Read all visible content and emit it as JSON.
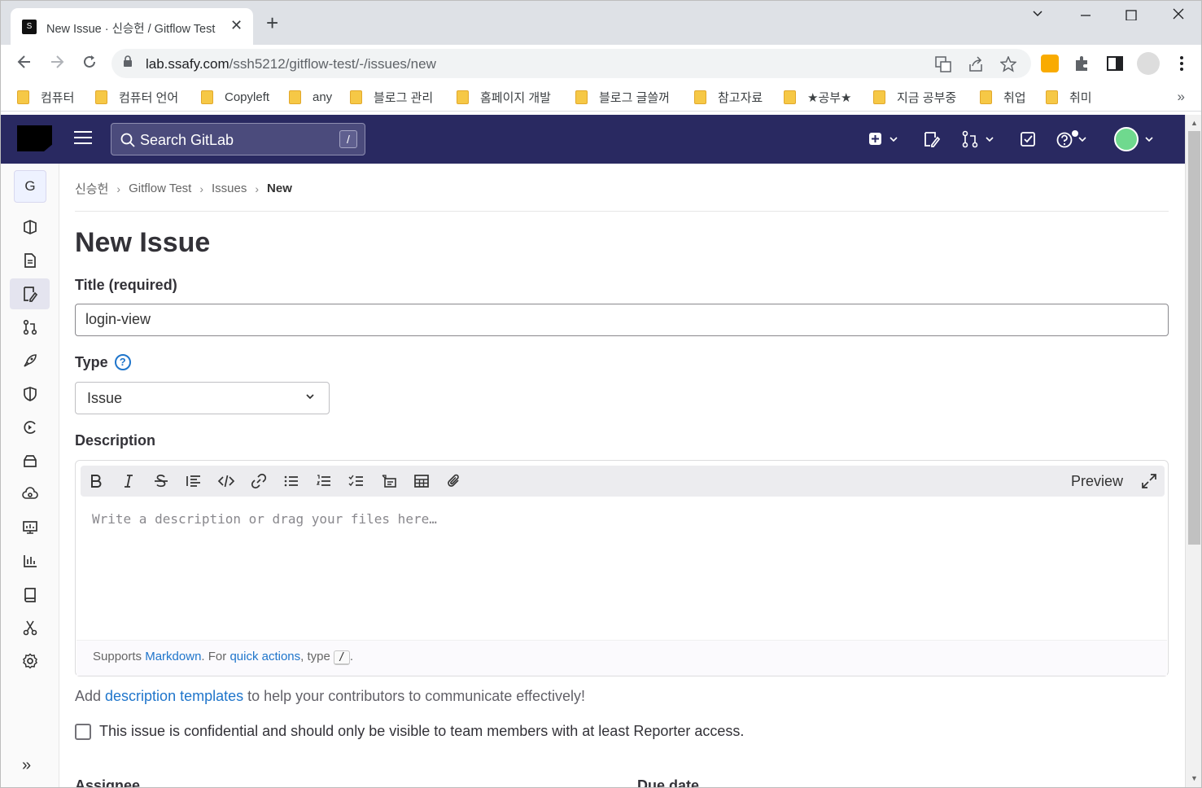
{
  "browser": {
    "tab_title": "New Issue · 신승헌 / Gitflow Test",
    "url_host": "lab.ssafy.com",
    "url_path": "/ssh5212/gitflow-test/-/issues/new",
    "bookmarks": [
      "컴퓨터",
      "컴퓨터 언어",
      "Copyleft",
      "any",
      "블로그 관리",
      "홈페이지 개발",
      "블로그 글쓸꺼",
      "참고자료",
      "★공부★",
      "지금 공부중",
      "취업",
      "취미"
    ],
    "bookmarks_more": "»"
  },
  "gitlab_header": {
    "search_placeholder": "Search GitLab",
    "search_shortcut": "/"
  },
  "sidebar": {
    "project_initial": "G",
    "items": [
      "project-info",
      "repository",
      "issues",
      "merge-requests",
      "ci-cd",
      "security",
      "deployments",
      "packages",
      "infrastructure",
      "monitor",
      "analytics",
      "wiki",
      "snippets",
      "settings"
    ],
    "active": "issues",
    "collapse_label": "»"
  },
  "breadcrumb": [
    "신승헌",
    "Gitflow Test",
    "Issues",
    "New"
  ],
  "page": {
    "heading": "New Issue",
    "title_label": "Title (required)",
    "title_value": "login-view",
    "type_label": "Type",
    "type_help": "?",
    "type_value": "Issue",
    "description_label": "Description",
    "preview_label": "Preview",
    "description_placeholder": "Write a description or drag your files here…",
    "supports_prefix": "Supports ",
    "markdown_link": "Markdown",
    "for_text": ". For ",
    "quick_actions_link": "quick actions",
    "type_text": ", type ",
    "slash_key": "/",
    "period": ".",
    "templates_prefix": "Add ",
    "templates_link": "description templates",
    "templates_suffix": " to help your contributors to communicate effectively!",
    "confidential_text": "This issue is confidential and should only be visible to team members with at least Reporter access.",
    "assignee_label": "Assignee",
    "due_date_label": "Due date"
  }
}
